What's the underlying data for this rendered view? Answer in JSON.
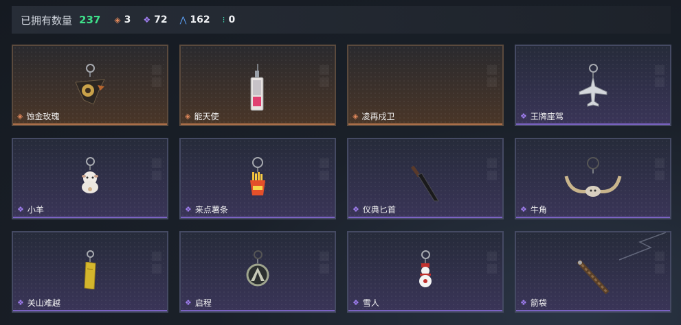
{
  "header": {
    "title": "已拥有数量",
    "count": "237",
    "stats": [
      {
        "icon": "gold-diamond-icon",
        "color": "#e0875a",
        "value": "3"
      },
      {
        "icon": "purple-diamond-icon",
        "color": "#a07ef0",
        "value": "72"
      },
      {
        "icon": "blue-chevron-icon",
        "color": "#5a9cf0",
        "value": "162"
      },
      {
        "icon": "green-dots-icon",
        "color": "#3fd8b0",
        "value": "0"
      }
    ]
  },
  "items": [
    {
      "name": "蚀金玫瑰",
      "rarity": "gold",
      "icon": "rose-charm-icon"
    },
    {
      "name": "能天使",
      "rarity": "gold",
      "icon": "angel-card-charm-icon"
    },
    {
      "name": "凌再戍卫",
      "rarity": "gold",
      "icon": "empty-charm-slot"
    },
    {
      "name": "王牌座驾",
      "rarity": "purple",
      "icon": "jet-charm-icon"
    },
    {
      "name": "小羊",
      "rarity": "purple",
      "icon": "lamb-charm-icon"
    },
    {
      "name": "来点薯条",
      "rarity": "purple",
      "icon": "fries-charm-icon"
    },
    {
      "name": "仪典匕首",
      "rarity": "purple",
      "icon": "dagger-charm-icon"
    },
    {
      "name": "牛角",
      "rarity": "purple",
      "icon": "horns-charm-icon"
    },
    {
      "name": "关山难越",
      "rarity": "purple",
      "icon": "gold-bar-charm-icon"
    },
    {
      "name": "启程",
      "rarity": "purple",
      "icon": "medallion-charm-icon"
    },
    {
      "name": "雪人",
      "rarity": "purple",
      "icon": "snowman-charm-icon"
    },
    {
      "name": "箭袋",
      "rarity": "purple",
      "icon": "quiver-charm-icon"
    }
  ]
}
